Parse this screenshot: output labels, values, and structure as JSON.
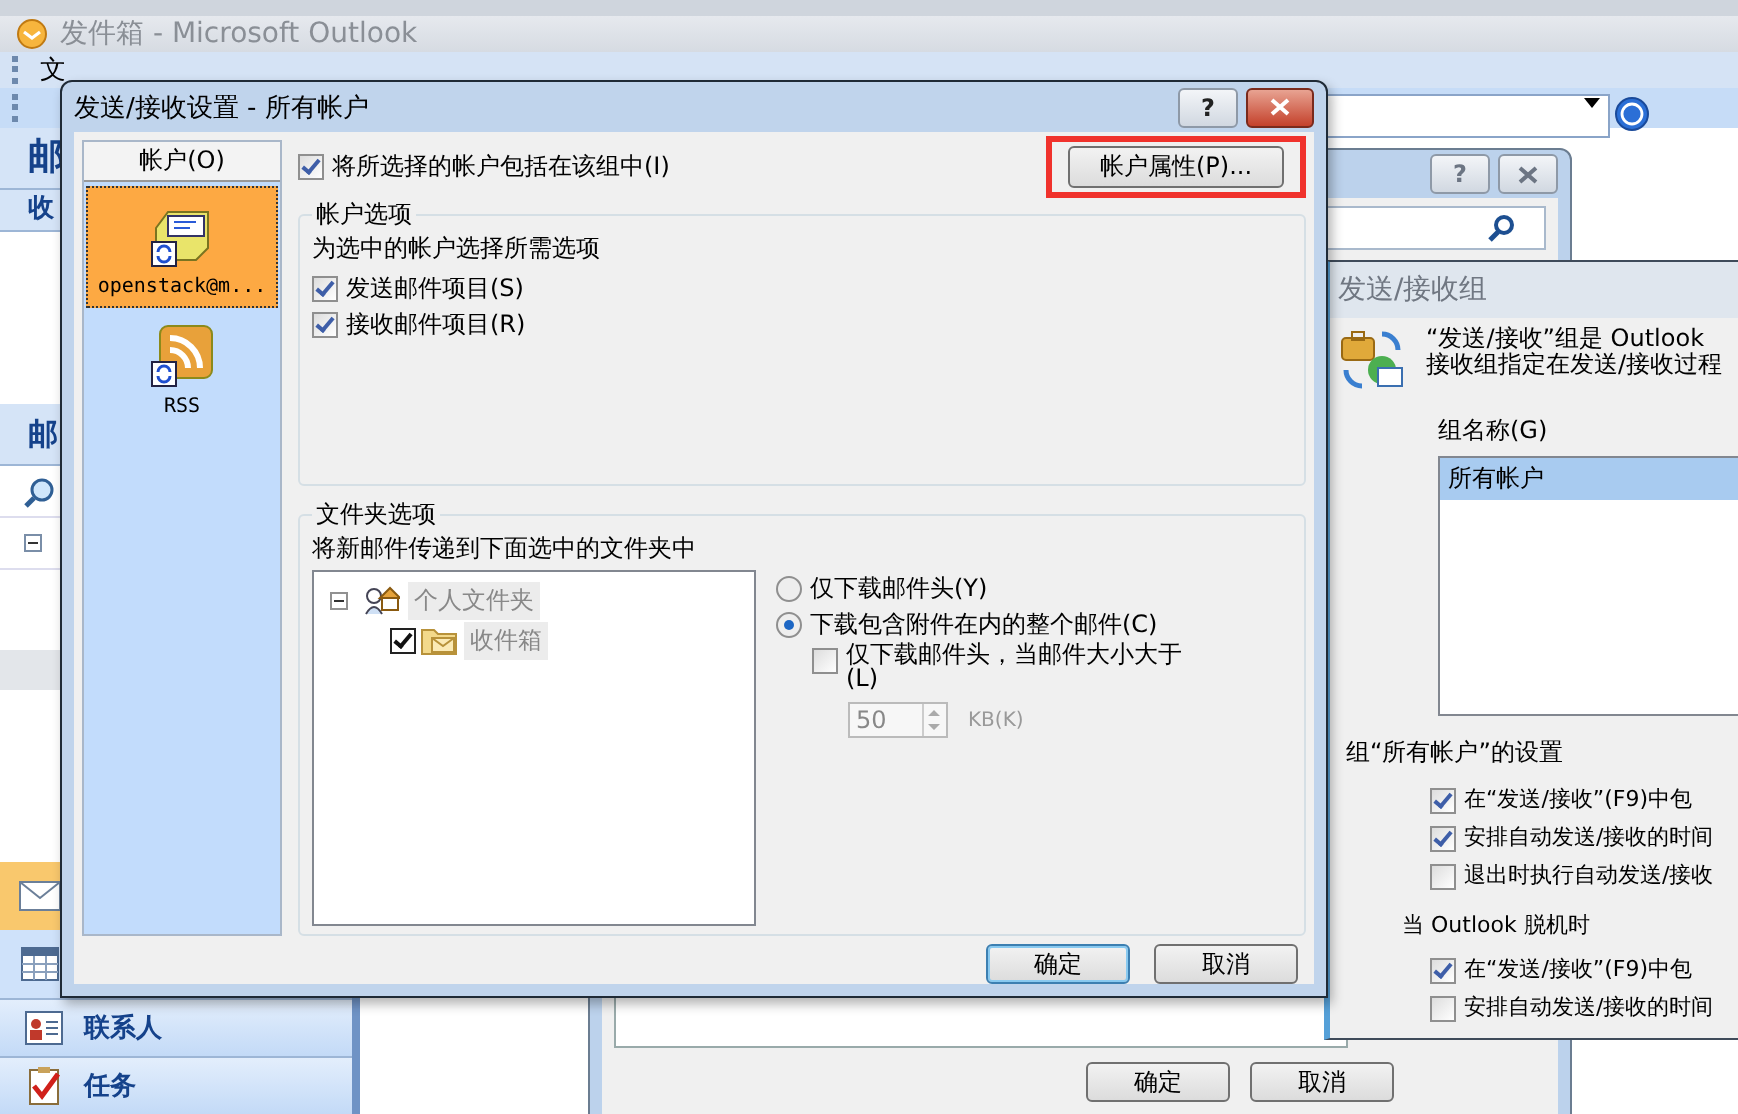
{
  "outlook": {
    "title": "发件箱 - Microsoft Outlook",
    "menu": [
      "文"
    ],
    "nav_headers": [
      "邮",
      "收",
      "邮"
    ],
    "nav_buttons": [
      {
        "label": "联系人",
        "kind": "contacts"
      },
      {
        "label": "任务",
        "kind": "tasks"
      }
    ]
  },
  "dialog_behind": {
    "help": "?",
    "buttons": [
      "确定",
      "取消"
    ]
  },
  "group_dialog": {
    "title": "发送/接收组",
    "intro": [
      "“发送/接收”组是 Outlook",
      "接收组指定在发送/接收过程"
    ],
    "columns": [
      "组名称(G)"
    ],
    "rows": [
      {
        "cells": [
          "所有帐户"
        ],
        "selected": true
      }
    ],
    "settings_title": "组“所有帐户”的设置",
    "online": [
      {
        "label": "在“发送/接收”(F9)中包",
        "checked": true
      },
      {
        "label": "安排自动发送/接收的时间",
        "checked": true
      },
      {
        "label": "退出时执行自动发送/接收",
        "checked": false
      }
    ],
    "offline_title": "当 Outlook 脱机时",
    "offline": [
      {
        "label": "在“发送/接收”(F9)中包",
        "checked": true
      },
      {
        "label": "安排自动发送/接收的时间",
        "checked": false
      }
    ]
  },
  "settings_dialog": {
    "title": "发送/接收设置 - 所有帐户",
    "help": "?",
    "accounts_header": "帐户(O)",
    "accounts": [
      {
        "label": "openstack@m...",
        "kind": "mail",
        "selected": true
      },
      {
        "label": "RSS",
        "kind": "rss",
        "selected": false
      }
    ],
    "include": {
      "label": "将所选择的帐户包括在该组中(I)",
      "checked": true
    },
    "properties_button": {
      "label": "帐户属性(P)...",
      "highlighted": true
    },
    "account_options": {
      "title": "帐户选项",
      "hint": "为选中的帐户选择所需选项",
      "options": [
        {
          "label": "发送邮件项目(S)",
          "checked": true
        },
        {
          "label": "接收邮件项目(R)",
          "checked": true
        }
      ]
    },
    "folder_options": {
      "title": "文件夹选项",
      "hint": "将新邮件传递到下面选中的文件夹中",
      "tree": [
        {
          "label": "个人文件夹",
          "expanded": true,
          "children": [
            {
              "label": "收件箱",
              "checked": true
            }
          ]
        }
      ],
      "download": [
        {
          "label": "仅下载邮件头(Y)",
          "selected": false
        },
        {
          "label": "下载包含附件在内的整个邮件(C)",
          "selected": true
        }
      ],
      "size_limit": {
        "label": "仅下载邮件头，当邮件大小大于(L)",
        "checked": false
      },
      "size": {
        "value": "50",
        "unit": "KB(K)",
        "disabled": true
      }
    },
    "buttons": [
      {
        "label": "确定",
        "default": true
      },
      {
        "label": "取消",
        "default": false
      }
    ]
  }
}
